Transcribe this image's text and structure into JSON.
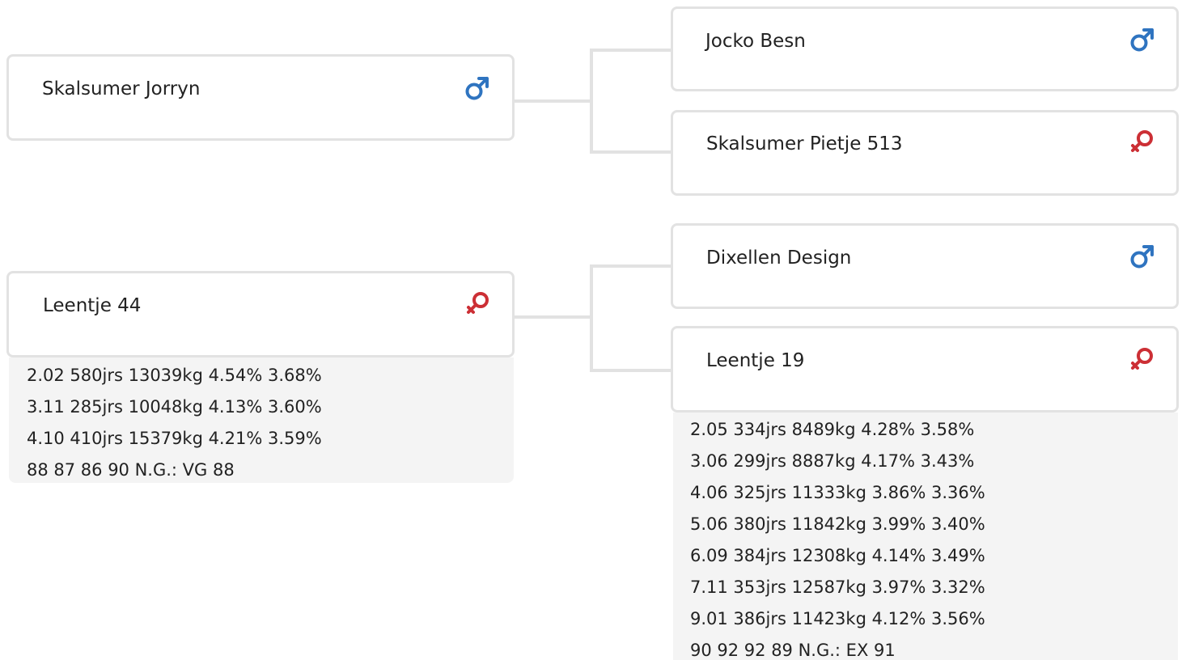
{
  "colors": {
    "male": "#2f74c0",
    "female": "#cc2f35",
    "border": "#e2e2e2",
    "stats_bg": "#f4f4f4"
  },
  "pedigree": {
    "sire": {
      "name": "Skalsumer Jorryn",
      "sex_icon": "male-icon",
      "sire": {
        "name": "Jocko Besn",
        "sex_icon": "male-icon"
      },
      "dam": {
        "name": "Skalsumer Pietje 513",
        "sex_icon": "female-icon"
      }
    },
    "dam": {
      "name": "Leentje 44",
      "sex_icon": "female-icon",
      "stats": [
        "2.02 580jrs 13039kg 4.54% 3.68%",
        "3.11 285jrs 10048kg 4.13% 3.60%",
        "4.10 410jrs 15379kg 4.21% 3.59%",
        "88 87 86 90 N.G.: VG 88"
      ],
      "sire": {
        "name": "Dixellen Design",
        "sex_icon": "male-icon"
      },
      "dam": {
        "name": "Leentje 19",
        "sex_icon": "female-icon",
        "stats": [
          "2.05 334jrs 8489kg 4.28% 3.58%",
          "3.06 299jrs 8887kg 4.17% 3.43%",
          "4.06 325jrs 11333kg 3.86% 3.36%",
          "5.06 380jrs 11842kg 3.99% 3.40%",
          "6.09 384jrs 12308kg 4.14% 3.49%",
          "7.11 353jrs 12587kg 3.97% 3.32%",
          "9.01 386jrs 11423kg 4.12% 3.56%",
          "90 92 92 89 N.G.: EX 91"
        ]
      }
    }
  }
}
